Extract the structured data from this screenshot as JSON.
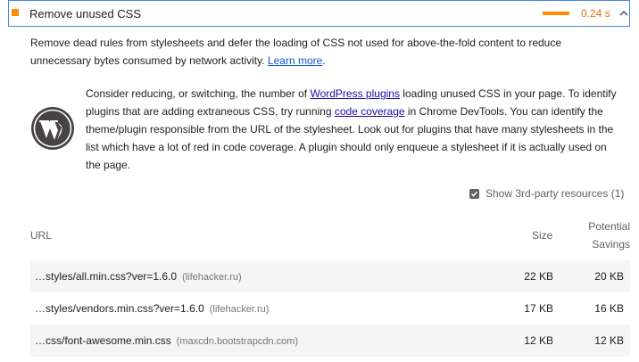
{
  "audit": {
    "title": "Remove unused CSS",
    "value": "0.24 s",
    "severity_color": "#fa8c00",
    "value_color": "#e8710a",
    "expanded": true
  },
  "description": {
    "text": "Remove dead rules from stylesheets and defer the loading of CSS not used for above-the-fold content to reduce unnecessary bytes consumed by network activity.",
    "learn_more": "Learn more",
    "period": "."
  },
  "stack_pack": {
    "icon": "wordpress-logo-icon",
    "t1": "Consider reducing, or switching, the number of ",
    "link1": "WordPress plugins",
    "t2": " loading unused CSS in your page. To identify plugins that are adding extraneous CSS, try running ",
    "link2": "code coverage",
    "t3": " in Chrome DevTools. You can identify the theme/plugin responsible from the URL of the stylesheet. Look out for plugins that have many stylesheets in the list which have a lot of red in code coverage. A plugin should only enqueue a stylesheet if it is actually used on the page."
  },
  "third_party": {
    "label": "Show 3rd-party resources (1)",
    "checked": true
  },
  "table": {
    "headers": {
      "url": "URL",
      "size": "Size",
      "savings_line1": "Potential",
      "savings_line2": "Savings"
    },
    "rows": [
      {
        "url": "…styles/all.min.css?ver=1.6.0",
        "host": "(lifehacker.ru)",
        "size": "22 KB",
        "savings": "20 KB"
      },
      {
        "url": "…styles/vendors.min.css?ver=1.6.0",
        "host": "(lifehacker.ru)",
        "size": "17 KB",
        "savings": "16 KB"
      },
      {
        "url": "…css/font-awesome.min.css",
        "host": "(maxcdn.bootstrapcdn.com)",
        "size": "12 KB",
        "savings": "12 KB"
      }
    ]
  }
}
